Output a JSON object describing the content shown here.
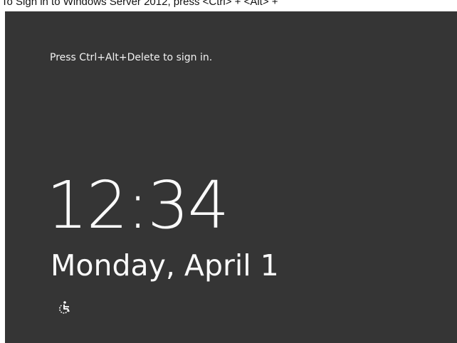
{
  "caption": "To Sign in to Windows Server 2012, press <Ctrl> + <Alt> +",
  "lockscreen": {
    "prompt": "Press Ctrl+Alt+Delete to sign in.",
    "time": "12:34",
    "date": "Monday, April 1",
    "ease_of_access_icon": "ease-of-access-icon",
    "background_color": "#353535",
    "text_color": "#fafafa"
  }
}
